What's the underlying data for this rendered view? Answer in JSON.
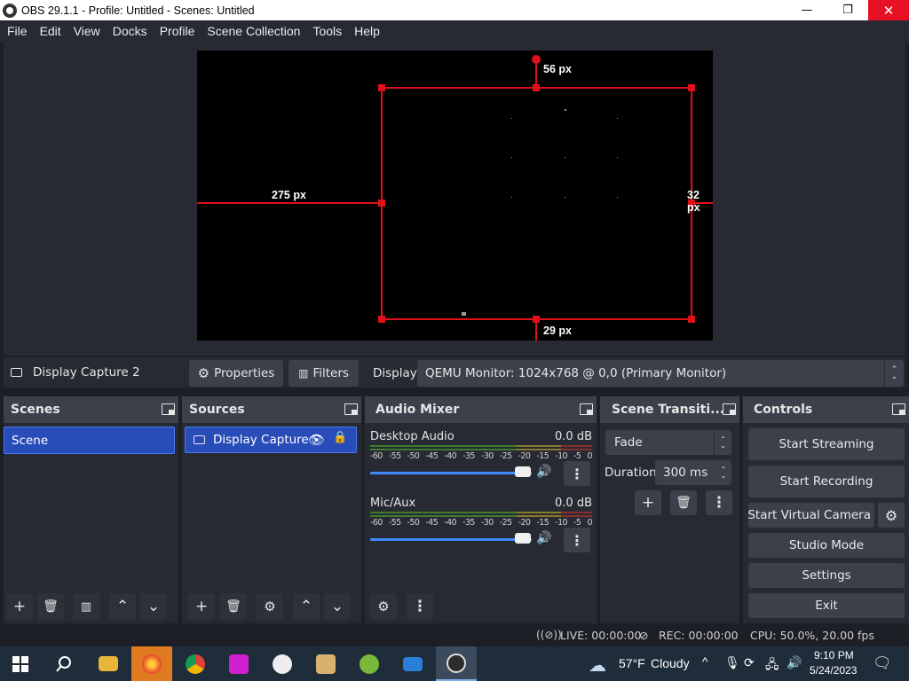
{
  "window": {
    "title": "OBS 29.1.1 - Profile: Untitled - Scenes: Untitled",
    "minimize": "—",
    "maximize": "❐",
    "close": "✕"
  },
  "menu": [
    "File",
    "Edit",
    "View",
    "Docks",
    "Profile",
    "Scene Collection",
    "Tools",
    "Help"
  ],
  "preview": {
    "top_distance": "56 px",
    "left_distance": "275 px",
    "right_distance": "32 px",
    "bottom_distance": "29 px"
  },
  "source_toolbar": {
    "selected_source": "Display Capture 2",
    "properties_label": "Properties",
    "filters_label": "Filters",
    "display_label": "Display",
    "display_value": "QEMU Monitor: 1024x768 @ 0,0 (Primary Monitor)"
  },
  "scenes": {
    "title": "Scenes",
    "items": [
      "Scene"
    ]
  },
  "sources": {
    "title": "Sources",
    "items": [
      "Display Capture :"
    ]
  },
  "audio_mixer": {
    "title": "Audio Mixer",
    "ticks": [
      "-60",
      "-55",
      "-50",
      "-45",
      "-40",
      "-35",
      "-30",
      "-25",
      "-20",
      "-15",
      "-10",
      "-5",
      "0"
    ],
    "channels": [
      {
        "name": "Desktop Audio",
        "level": "0.0 dB",
        "volume": 1.0
      },
      {
        "name": "Mic/Aux",
        "level": "0.0 dB",
        "volume": 1.0
      }
    ]
  },
  "transitions": {
    "title": "Scene Transiti...",
    "selected": "Fade",
    "duration_label": "Duration",
    "duration_value": "300 ms"
  },
  "controls": {
    "title": "Controls",
    "start_streaming": "Start Streaming",
    "start_recording": "Start Recording",
    "start_virtual_camera": "Start Virtual Camera",
    "studio_mode": "Studio Mode",
    "settings": "Settings",
    "exit": "Exit"
  },
  "status": {
    "live": "LIVE: 00:00:00",
    "rec": "REC: 00:00:00",
    "cpu": "CPU: 50.0%, 20.00 fps"
  },
  "taskbar": {
    "weather_temp": "57°F",
    "weather_text": "Cloudy",
    "time": "9:10 PM",
    "date": "5/24/2023"
  },
  "colors": {
    "accent": "#284cb8",
    "bounding_box": "#e0101a",
    "panel": "#272a33",
    "header": "#3c404b",
    "taskbar": "#1f2c3a"
  }
}
